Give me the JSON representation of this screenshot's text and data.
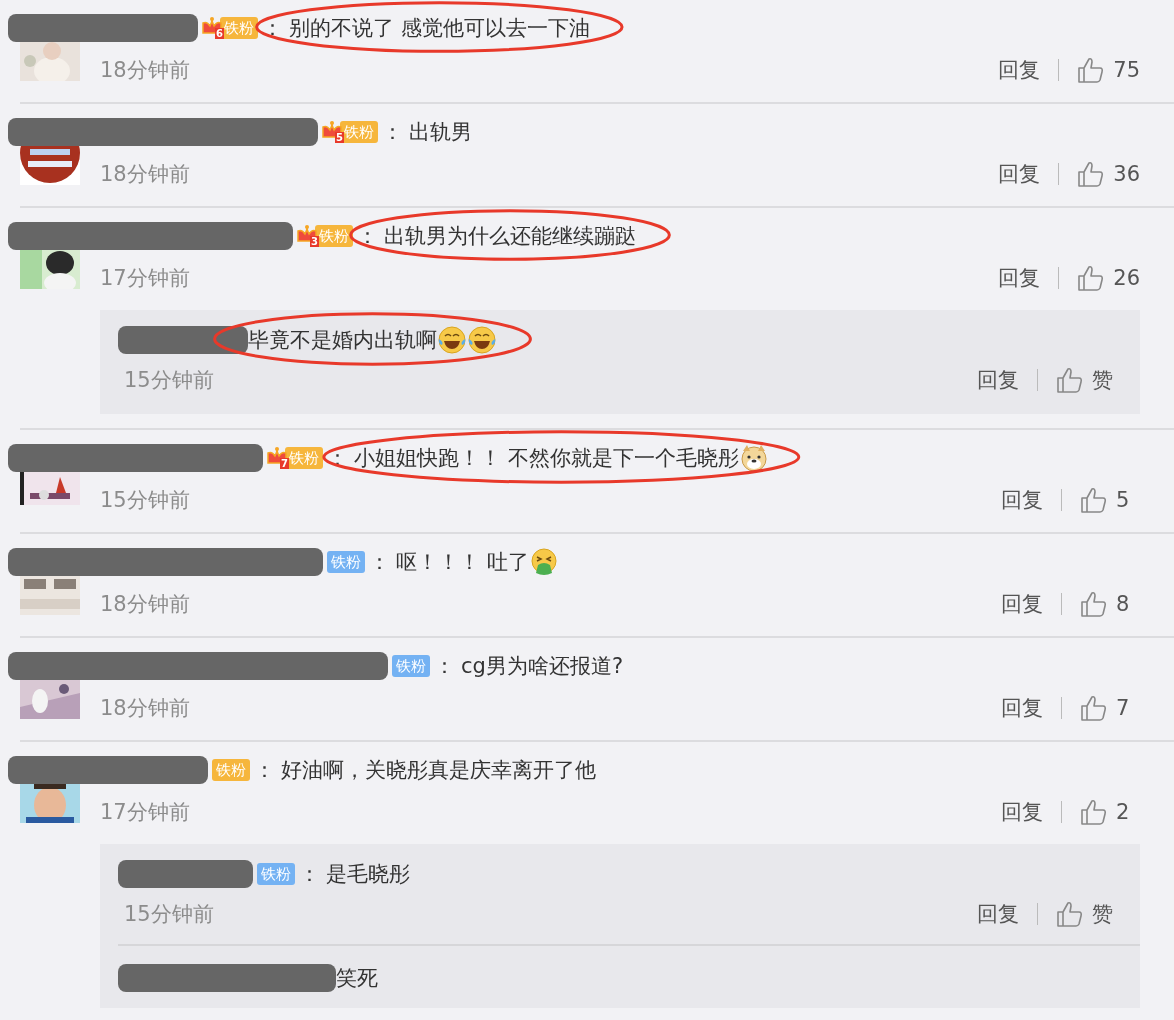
{
  "comments": [
    {
      "avatar": {
        "kind": "picture"
      },
      "badge": {
        "kind": "gold",
        "level": "6",
        "label": "铁粉"
      },
      "colon": "：",
      "text": "别的不说了 感觉他可以去一下油",
      "circled": true,
      "time": "18分钟前",
      "reply": "回复",
      "likes": "75"
    },
    {
      "avatar": {
        "kind": "picture"
      },
      "badge": {
        "kind": "gold",
        "level": "5",
        "label": "铁粉"
      },
      "colon": "：",
      "text": "出轨男",
      "circled": false,
      "time": "18分钟前",
      "reply": "回复",
      "likes": "36"
    },
    {
      "avatar": {
        "kind": "picture"
      },
      "badge": {
        "kind": "gold",
        "level": "3",
        "label": "铁粉"
      },
      "colon": "：",
      "text": "出轨男为什么还能继续蹦跶",
      "circled": true,
      "time": "17分钟前",
      "reply": "回复",
      "likes": "26",
      "replies": [
        {
          "text": "毕竟不是婚内出轨啊",
          "emojis": [
            {
              "kind": "laugh-cry"
            },
            {
              "kind": "laugh-cry"
            }
          ],
          "circled": true,
          "time": "15分钟前",
          "reply": "回复",
          "likes": "赞"
        }
      ]
    },
    {
      "avatar": {
        "kind": "picture"
      },
      "badge": {
        "kind": "gold",
        "level": "7",
        "label": "铁粉"
      },
      "colon": "：",
      "text": "小姐姐快跑！！ 不然你就是下一个毛晓彤",
      "emojis": [
        {
          "kind": "dog"
        }
      ],
      "circled": true,
      "time": "15分钟前",
      "reply": "回复",
      "likes": "5"
    },
    {
      "avatar": {
        "kind": "picture"
      },
      "badge": {
        "kind": "blue",
        "label": "铁粉"
      },
      "colon": "：",
      "text": "呕！！！ 吐了",
      "emojis": [
        {
          "kind": "vomit"
        }
      ],
      "circled": false,
      "time": "18分钟前",
      "reply": "回复",
      "likes": "8"
    },
    {
      "avatar": {
        "kind": "picture"
      },
      "badge": {
        "kind": "blue",
        "label": "铁粉"
      },
      "colon": "：",
      "text": "cg男为啥还报道?",
      "circled": false,
      "time": "18分钟前",
      "reply": "回复",
      "likes": "7"
    },
    {
      "avatar": {
        "kind": "picture"
      },
      "badge": {
        "kind": "gold",
        "label": "铁粉"
      },
      "colon": "：",
      "text": "好油啊，关晓彤真是庆幸离开了他",
      "circled": false,
      "time": "17分钟前",
      "reply": "回复",
      "likes": "2",
      "replies": [
        {
          "badge": {
            "kind": "blue",
            "label": "铁粉"
          },
          "colon": "：",
          "text": "是毛晓彤",
          "circled": false,
          "time": "15分钟前",
          "reply": "回复",
          "likes": "赞"
        },
        {
          "text": "笑死",
          "circled": false
        }
      ]
    }
  ]
}
